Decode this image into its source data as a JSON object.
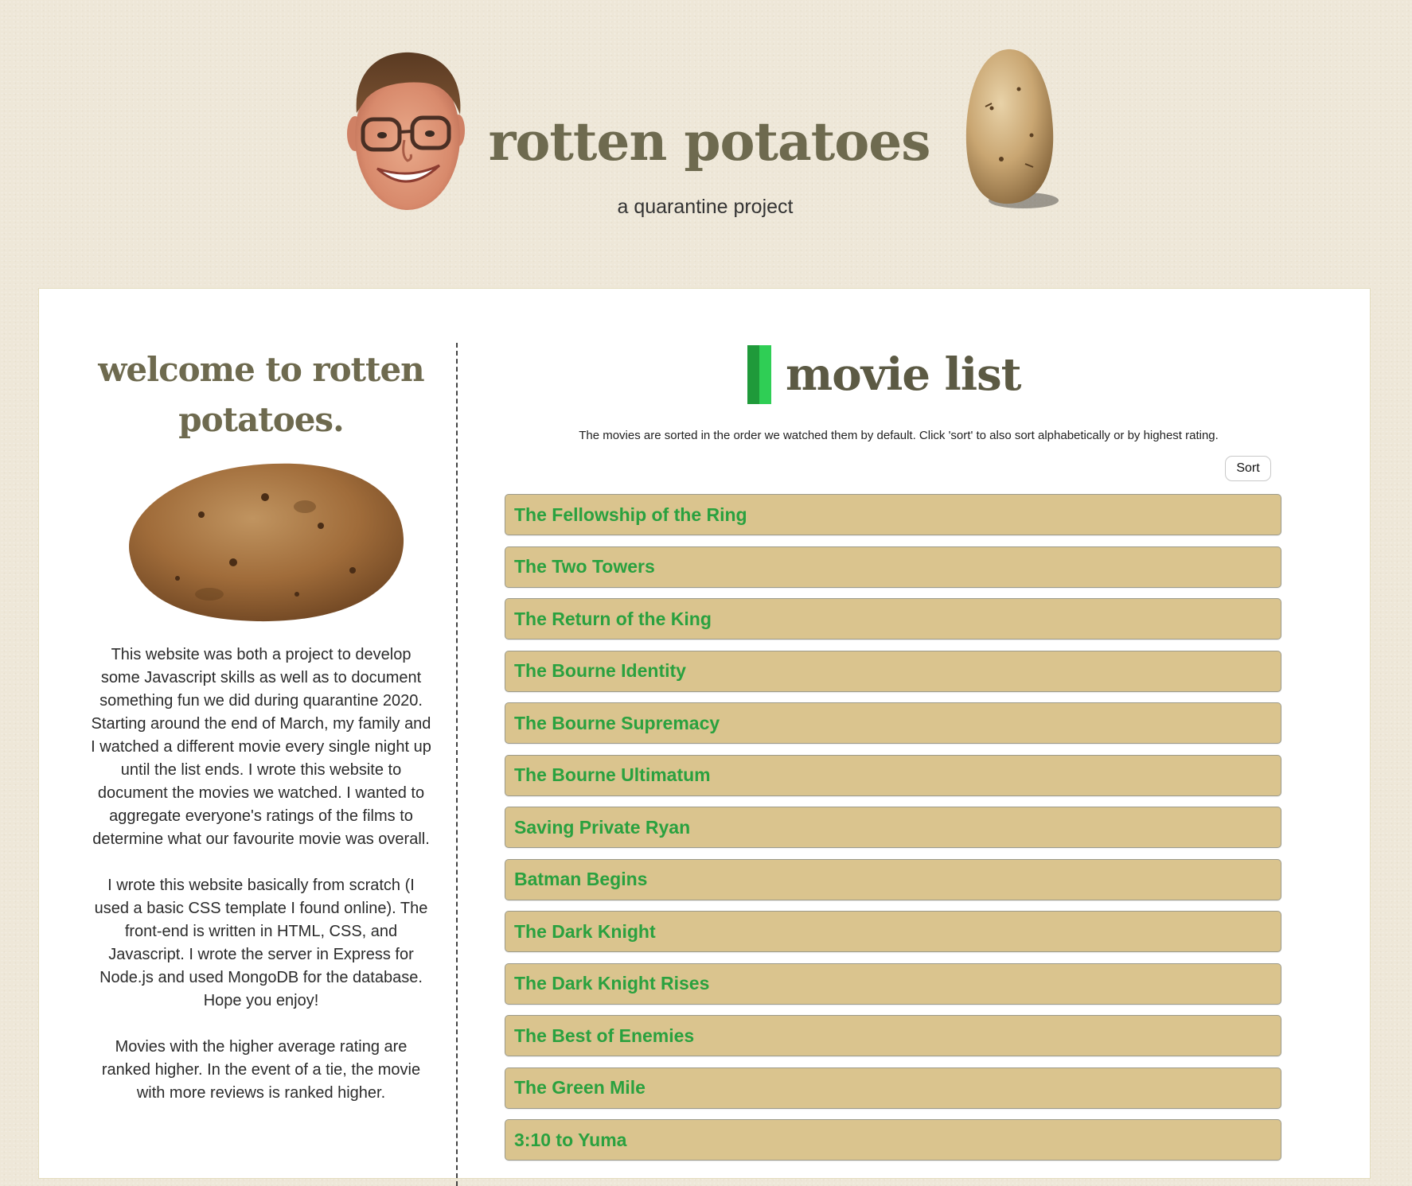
{
  "header": {
    "title": "rotten potatoes",
    "subtitle": "a quarantine project"
  },
  "welcome": {
    "heading": "welcome to rotten potatoes.",
    "paragraphs": [
      "This website was both a project to develop some Javascript skills as well as to document something fun we did during quarantine 2020. Starting around the end of March, my family and I watched a different movie every single night up until the list ends. I wrote this website to document the movies we watched. I wanted to aggregate everyone's ratings of the films to determine what our favourite movie was overall.",
      "I wrote this website basically from scratch (I used a basic CSS template I found online). The front-end is written in HTML, CSS, and Javascript. I wrote the server in Express for Node.js and used MongoDB for the database. Hope you enjoy!",
      "Movies with the higher average rating are ranked higher. In the event of a tie, the movie with more reviews is ranked higher."
    ]
  },
  "movie_list": {
    "title": "movie list",
    "note": "The movies are sorted in the order we watched them by default. Click 'sort' to also sort alphabetically or by highest rating.",
    "sort_label": "Sort",
    "movies": [
      "The Fellowship of the Ring",
      "The Two Towers",
      "The Return of the King",
      "The Bourne Identity",
      "The Bourne Supremacy",
      "The Bourne Ultimatum",
      "Saving Private Ryan",
      "Batman Begins",
      "The Dark Knight",
      "The Dark Knight Rises",
      "The Best of Enemies",
      "The Green Mile",
      "3:10 to Yuma"
    ]
  },
  "colors": {
    "background": "#eee7d8",
    "title": "#6e6a4f",
    "movie_item_bg": "#dac48e",
    "movie_title": "#2aa13f",
    "accent_dark": "#1f9a3a",
    "accent_light": "#2fce55"
  },
  "icons": {
    "face": "face-photo",
    "header_potato": "potato-image",
    "welcome_potato": "potato-image"
  }
}
